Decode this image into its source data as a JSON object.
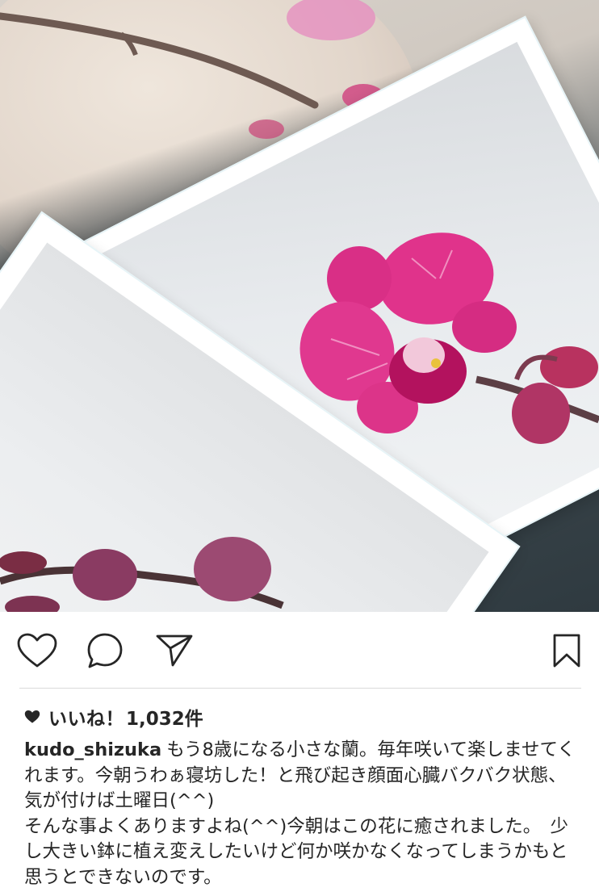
{
  "post": {
    "photo_alt_subject": "pink-orchid",
    "likes_label": "いいね！",
    "likes_count": "1,032件",
    "username": "kudo_shizuka",
    "caption_line1": "もう8歳になる小さな蘭。毎年咲いて楽しませてくれます。今朝うわぁ寝坊した！と飛び起き顔面心臓バクバク状態、気が付けば土曜日(^^)",
    "caption_line2": "そんな事よくありますよね(^^)今朝はこの花に癒されました。　少し大きい鉢に植え変えしたいけど何か咲かなくなってしまうかもと思うとできないのです。"
  },
  "actions": {
    "like_icon": "heart-outline-icon",
    "comment_icon": "comment-bubble-icon",
    "share_icon": "paper-plane-icon",
    "save_icon": "bookmark-icon"
  },
  "colors": {
    "text": "#262626",
    "divider": "#dbdbdb",
    "orchid": "#d6247d"
  }
}
